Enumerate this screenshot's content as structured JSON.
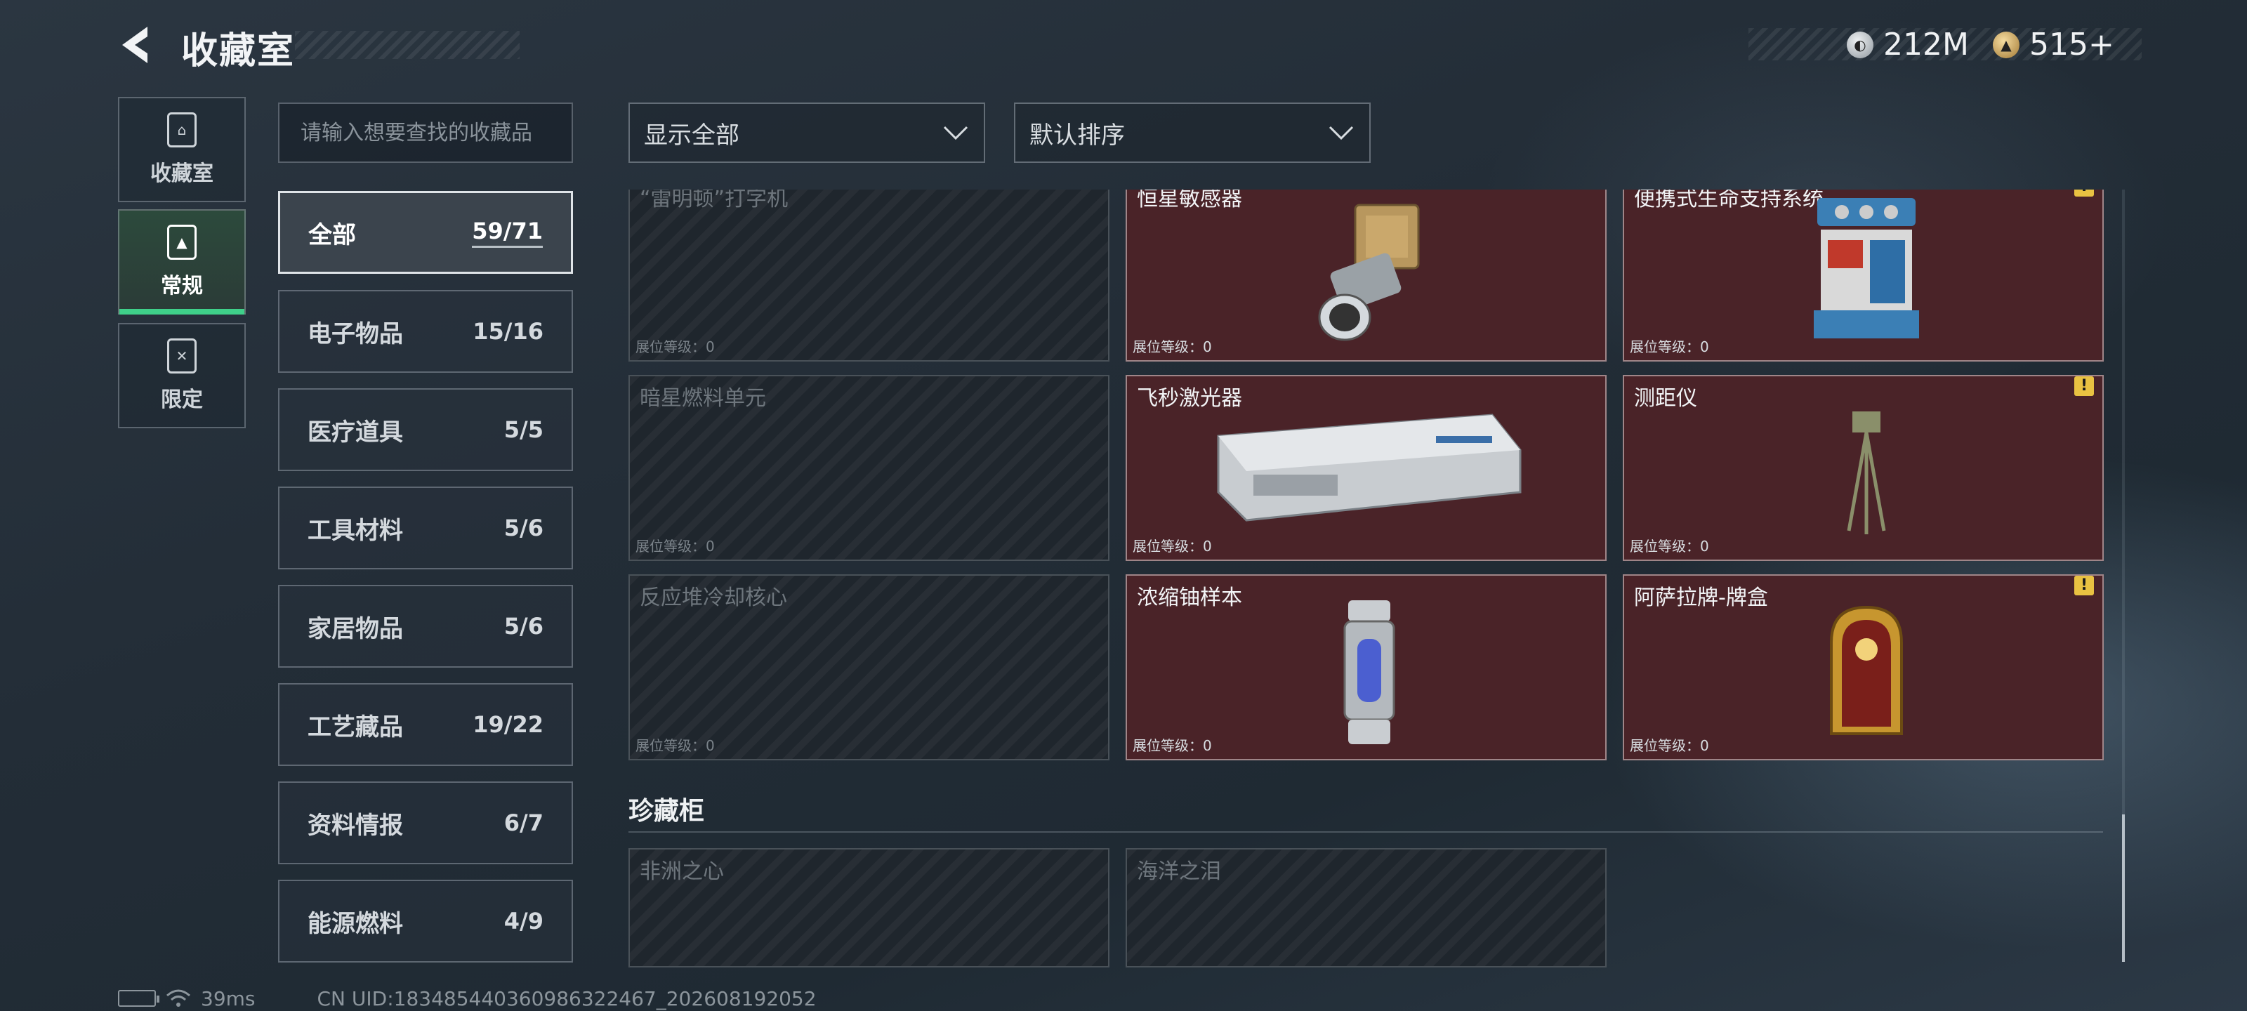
{
  "header": {
    "title": "收藏室",
    "currencies": [
      {
        "icon": "silver-coin-icon",
        "value": "212M",
        "color": "#c9ced3"
      },
      {
        "icon": "gold-coin-icon",
        "value": "515+",
        "color": "#d8b56a"
      }
    ]
  },
  "mode_tabs": [
    {
      "label": "收藏室",
      "icon": "collection-room-icon",
      "active": false
    },
    {
      "label": "常规",
      "icon": "regular-icon",
      "active": true
    },
    {
      "label": "限定",
      "icon": "limited-icon",
      "active": false
    }
  ],
  "search": {
    "placeholder": "请输入想要查找的收藏品"
  },
  "categories": [
    {
      "name": "全部",
      "count": "59/71"
    },
    {
      "name": "电子物品",
      "count": "15/16"
    },
    {
      "name": "医疗道具",
      "count": "5/5"
    },
    {
      "name": "工具材料",
      "count": "5/6"
    },
    {
      "name": "家居物品",
      "count": "5/6"
    },
    {
      "name": "工艺藏品",
      "count": "19/22"
    },
    {
      "name": "资料情报",
      "count": "6/7"
    },
    {
      "name": "能源燃料",
      "count": "4/9"
    }
  ],
  "filters": {
    "display": "显示全部",
    "sort": "默认排序"
  },
  "items": [
    {
      "name": "“雷明顿”打字机",
      "level": "展位等级：0",
      "owned": false,
      "warn": false
    },
    {
      "name": "恒星敏感器",
      "level": "展位等级：0",
      "owned": true,
      "warn": false
    },
    {
      "name": "便携式生命支持系统",
      "level": "展位等级：0",
      "owned": true,
      "warn": true
    },
    {
      "name": "暗星燃料单元",
      "level": "展位等级：0",
      "owned": false,
      "warn": false
    },
    {
      "name": "飞秒激光器",
      "level": "展位等级：0",
      "owned": true,
      "warn": false
    },
    {
      "name": "测距仪",
      "level": "展位等级：0",
      "owned": true,
      "warn": true
    },
    {
      "name": "反应堆冷却核心",
      "level": "展位等级：0",
      "owned": false,
      "warn": false
    },
    {
      "name": "浓缩铀样本",
      "level": "展位等级：0",
      "owned": true,
      "warn": false
    },
    {
      "name": "阿萨拉牌-牌盒",
      "level": "展位等级：0",
      "owned": true,
      "warn": true
    }
  ],
  "cabinet": {
    "title": "珍藏柜",
    "items": [
      {
        "name": "非洲之心",
        "owned": false
      },
      {
        "name": "海洋之泪",
        "owned": false
      }
    ]
  },
  "footer": {
    "ping": "39ms",
    "uid": "CN UID:18348544036098632​2467_202608192052"
  },
  "warn_glyph": "!"
}
